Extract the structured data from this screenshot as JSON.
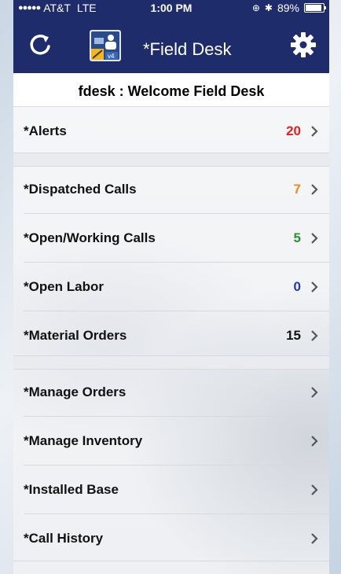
{
  "status_bar": {
    "carrier": "AT&T",
    "network": "LTE",
    "time": "1:00 PM",
    "battery": "89%"
  },
  "nav": {
    "title": "*Field Desk",
    "logo_badge": "v4"
  },
  "subheader": "fdesk : Welcome Field Desk",
  "rows": [
    {
      "label": "*Alerts",
      "count": "20",
      "count_color": "#e02020"
    },
    {
      "label": "*Dispatched Calls",
      "count": "7",
      "count_color": "#f08a1c"
    },
    {
      "label": "*Open/Working Calls",
      "count": "5",
      "count_color": "#2f8f2f"
    },
    {
      "label": "*Open Labor",
      "count": "0",
      "count_color": "#2438a8"
    },
    {
      "label": "*Material Orders",
      "count": "15",
      "count_color": "#111111"
    },
    {
      "label": "*Manage Orders",
      "count": "",
      "count_color": "#111111"
    },
    {
      "label": "*Manage Inventory",
      "count": "",
      "count_color": "#111111"
    },
    {
      "label": "*Installed Base",
      "count": "",
      "count_color": "#111111"
    },
    {
      "label": "*Call History",
      "count": "",
      "count_color": "#111111"
    }
  ],
  "colors": {
    "header_bg": "#1f2c6b",
    "accent_red": "#e02020",
    "accent_orange": "#f08a1c",
    "accent_green": "#2f8f2f",
    "accent_blue": "#2438a8"
  }
}
